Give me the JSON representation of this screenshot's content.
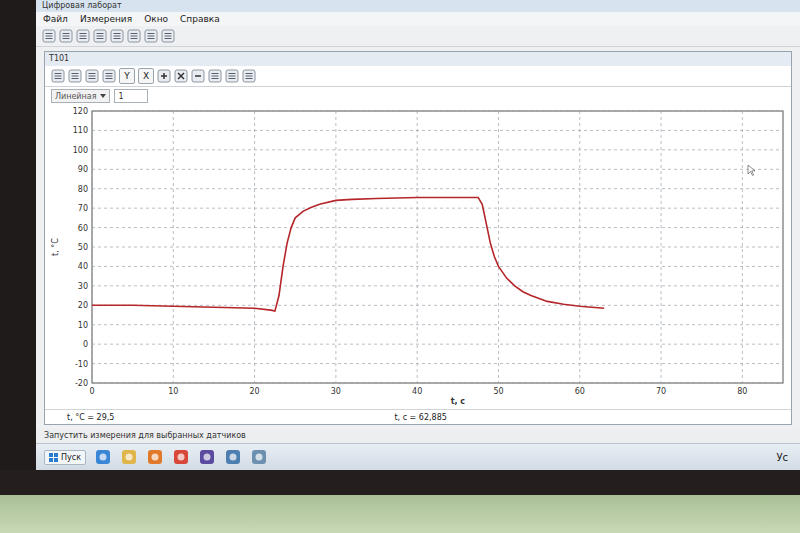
{
  "window": {
    "title": "Цифровая лаборат"
  },
  "menu": [
    "Файл",
    "Измерения",
    "Окно",
    "Справка"
  ],
  "chart_window": {
    "title": "T101",
    "scale_select": "Линейная",
    "scale_field": "1",
    "axis_buttons": [
      "Y",
      "X"
    ]
  },
  "chart": {
    "y_label": "t, °C",
    "x_label": "t, c",
    "y_ticks": [
      "120",
      "110",
      "100",
      "90",
      "80",
      "70",
      "60",
      "50",
      "40",
      "30",
      "20",
      "10",
      "0",
      "-10",
      "-20"
    ],
    "x_ticks": [
      "0",
      "10",
      "20",
      "30",
      "40",
      "50",
      "60",
      "70",
      "80"
    ],
    "series": [
      {
        "name": "T101",
        "time": [
          0,
          5,
          10,
          15,
          20,
          22,
          22.5,
          23,
          23.5,
          24,
          24.5,
          25,
          26,
          27,
          28,
          30,
          32,
          35,
          40,
          45,
          47.5,
          48,
          48.5,
          49,
          49.5,
          50,
          51,
          52,
          53,
          54,
          56,
          58,
          60,
          63
        ],
        "values": [
          20,
          20,
          19.5,
          19,
          18.5,
          17.5,
          17,
          25,
          40,
          52,
          60,
          65,
          68.5,
          70.5,
          72,
          74,
          74.5,
          75,
          75.5,
          75.5,
          75.5,
          72,
          62,
          52,
          45,
          40,
          34,
          30,
          27,
          25,
          22,
          20.5,
          19.5,
          18.5
        ]
      }
    ]
  },
  "readouts": {
    "y": "t, °C = 29,5",
    "x": "t, c = 62,885"
  },
  "status_bar": "Запустить измерения для выбранных датчиков",
  "taskbar": {
    "start": "Пуск",
    "tray_text": "Ус"
  }
}
